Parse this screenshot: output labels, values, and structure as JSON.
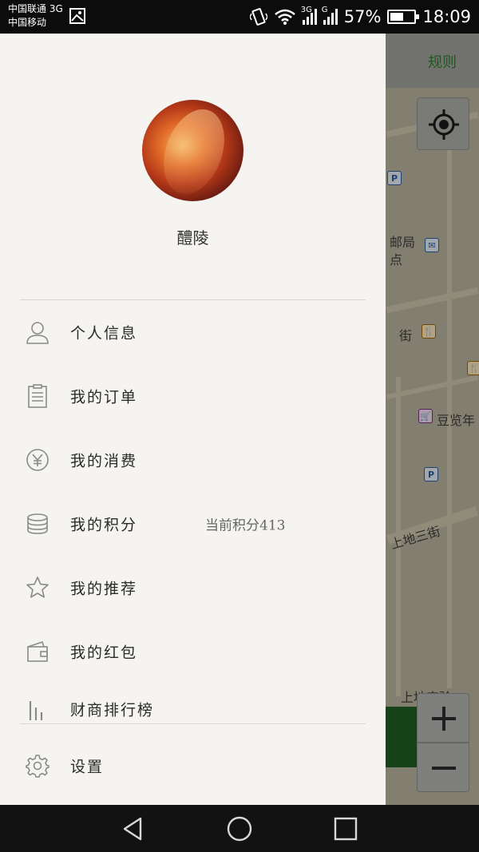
{
  "status_bar": {
    "carrier_line1": "中国联通 3G",
    "carrier_line2": "中国移动",
    "network1_tag": "3G",
    "network2_tag": "G",
    "battery_percent": "57%",
    "battery_level": 0.57,
    "time": "18:09"
  },
  "map": {
    "rules_label": "规则",
    "labels": [
      "邮局",
      "点",
      "街",
      "豆览年",
      "上地三街",
      "上地实验"
    ]
  },
  "drawer": {
    "username": "醴陵",
    "menu": [
      {
        "label": "个人信息",
        "icon": "person-icon"
      },
      {
        "label": "我的订单",
        "icon": "clipboard-icon"
      },
      {
        "label": "我的消费",
        "icon": "yen-icon"
      },
      {
        "label": "我的积分",
        "icon": "coins-icon",
        "extra": "当前积分413"
      },
      {
        "label": "我的推荐",
        "icon": "star-icon"
      },
      {
        "label": "我的红包",
        "icon": "wallet-icon"
      },
      {
        "label": "财商排行榜",
        "icon": "bar-chart-icon"
      }
    ],
    "settings_label": "设置"
  },
  "colors": {
    "drawer_bg": "#f5f4f1",
    "icon_gray": "#8a8a8a",
    "accent_green": "#2d7a2d"
  }
}
